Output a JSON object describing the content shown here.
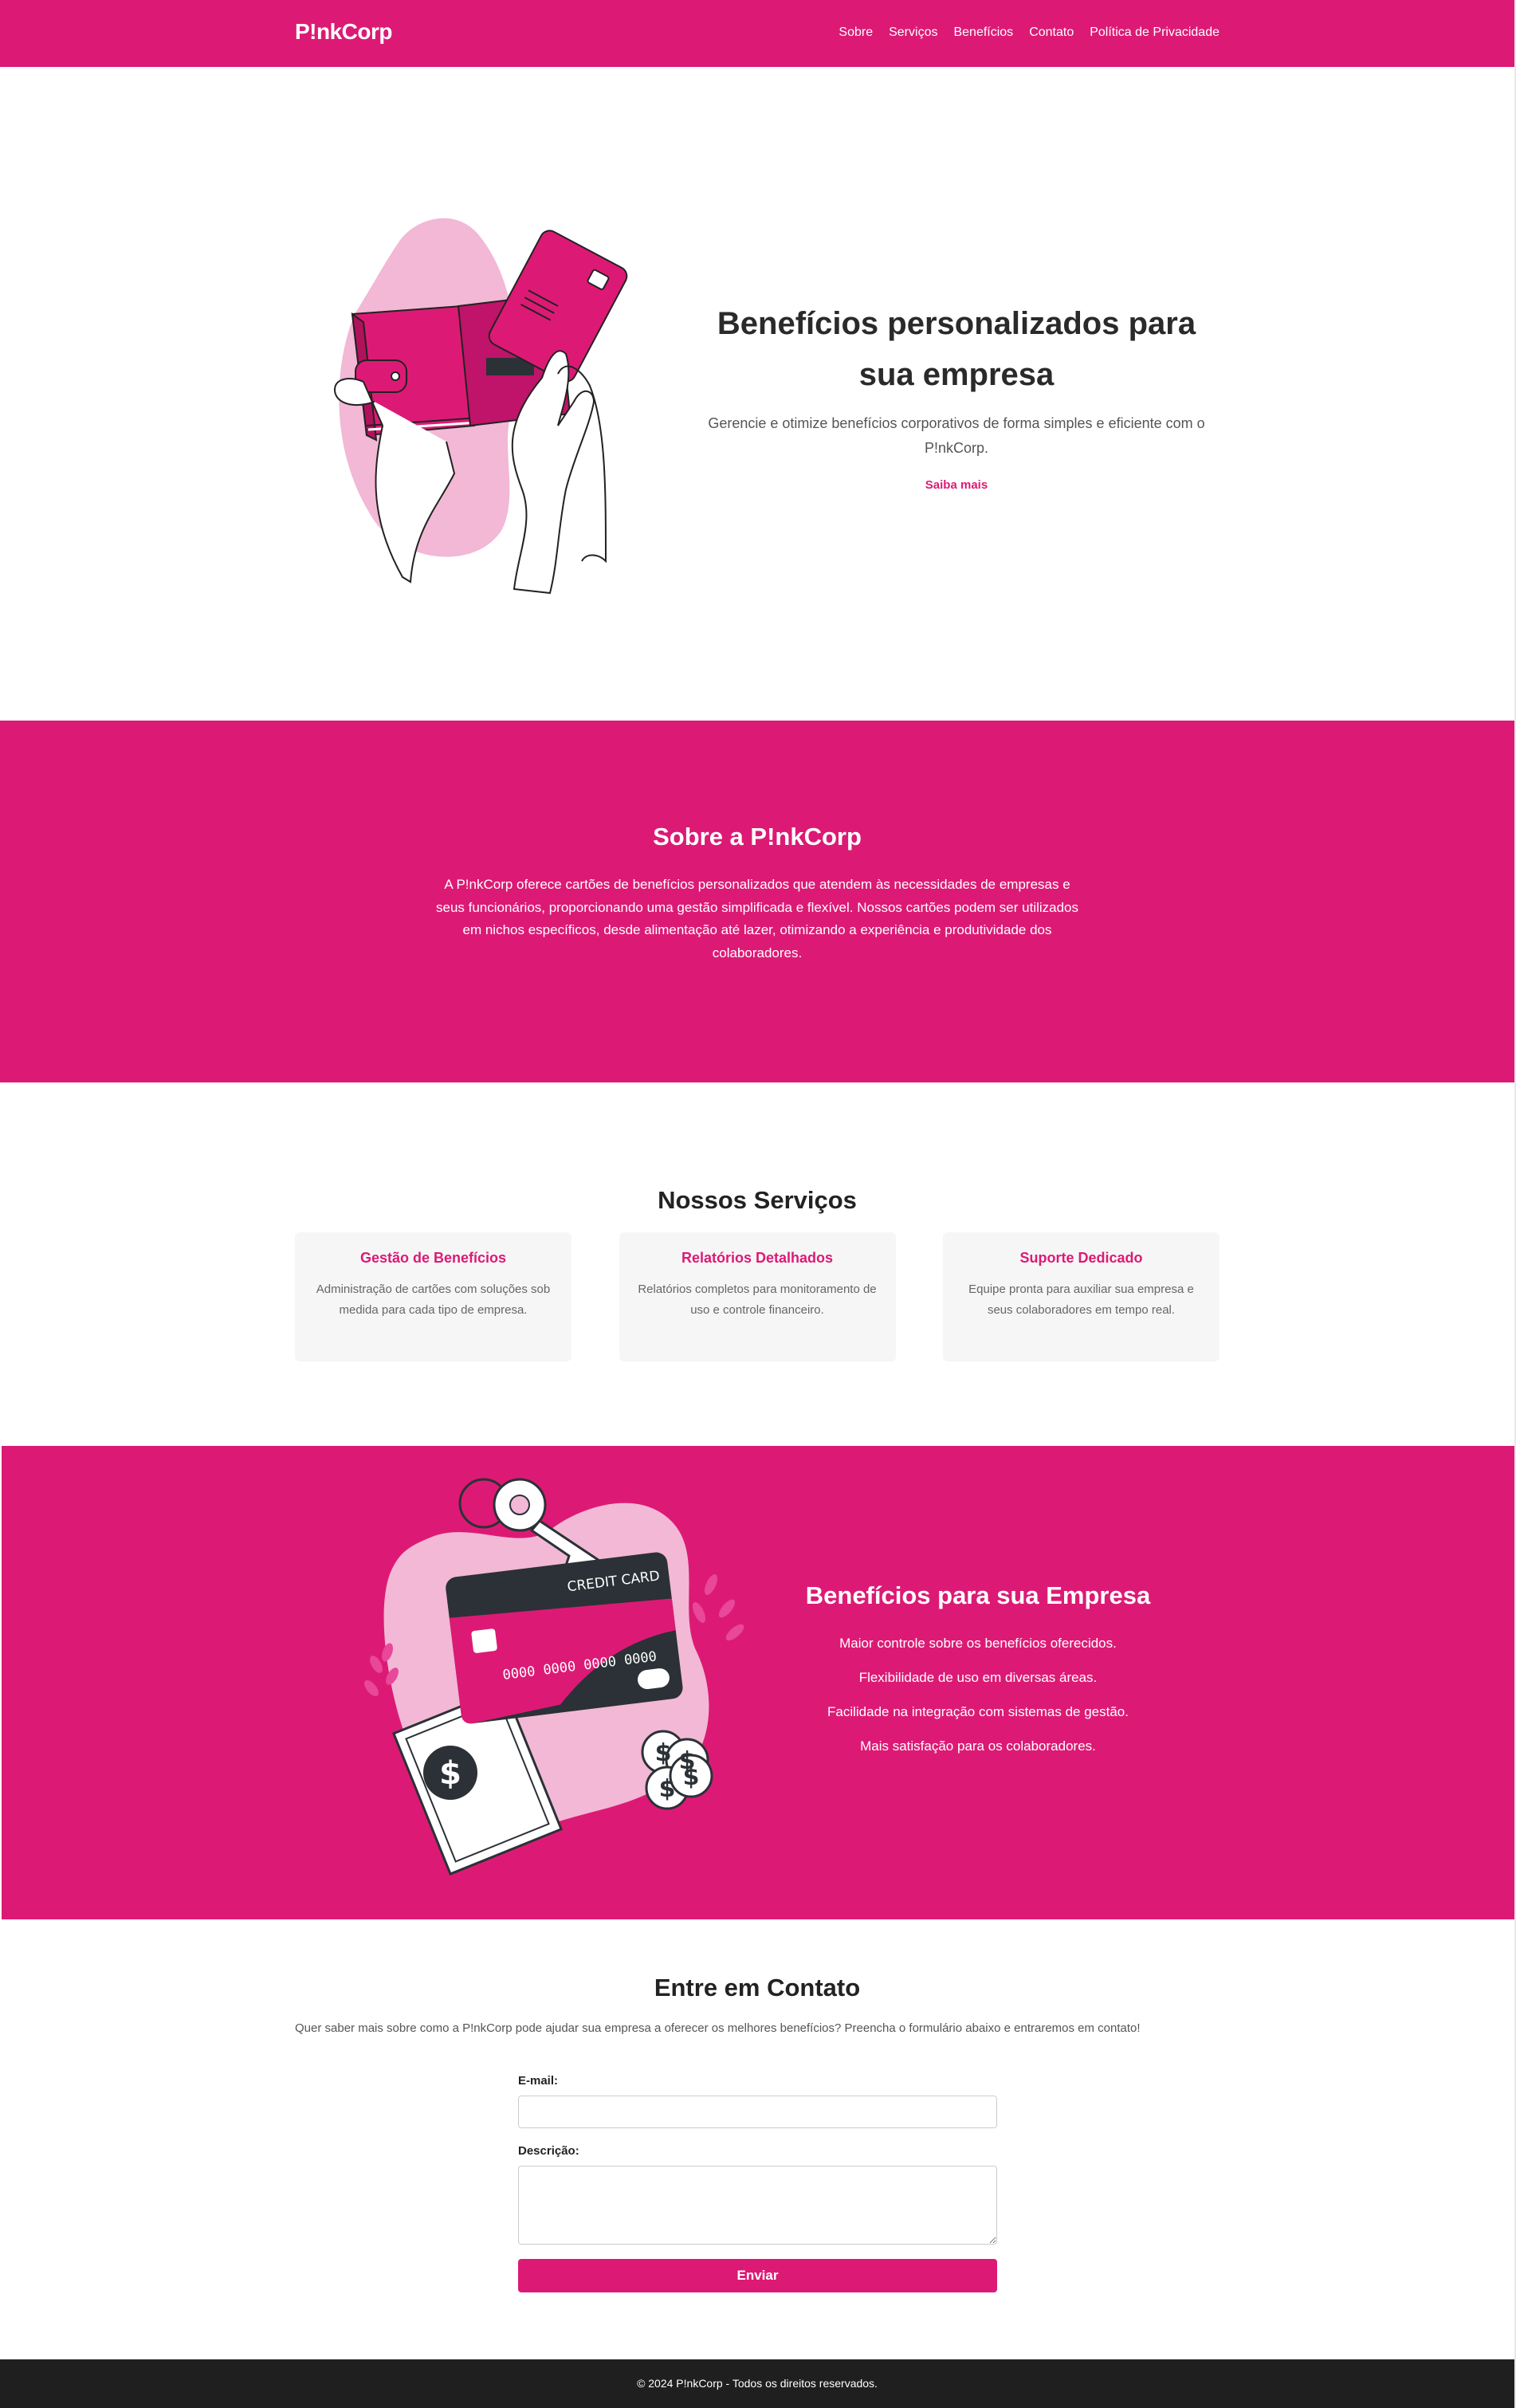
{
  "header": {
    "logo": "P!nkCorp",
    "nav": [
      "Sobre",
      "Serviços",
      "Benefícios",
      "Contato",
      "Política de Privacidade"
    ]
  },
  "hero": {
    "title": "Benefícios personalizados para sua empresa",
    "subtitle": "Gerencie e otimize benefícios corporativos de forma simples e eficiente com o P!nkCorp.",
    "link": "Saiba mais"
  },
  "about": {
    "title": "Sobre a P!nkCorp",
    "text": "A P!nkCorp oferece cartões de benefícios personalizados que atendem às necessidades de empresas e seus funcionários, proporcionando uma gestão simplificada e flexível. Nossos cartões podem ser utilizados em nichos específicos, desde alimentação até lazer, otimizando a experiência e produtividade dos colaboradores."
  },
  "services": {
    "title": "Nossos Serviços",
    "cards": [
      {
        "title": "Gestão de Benefícios",
        "text": "Administração de cartões com soluções sob medida para cada tipo de empresa."
      },
      {
        "title": "Relatórios Detalhados",
        "text": "Relatórios completos para monitoramento de uso e controle financeiro."
      },
      {
        "title": "Suporte Dedicado",
        "text": "Equipe pronta para auxiliar sua empresa e seus colaboradores em tempo real."
      }
    ]
  },
  "benefits": {
    "title": "Benefícios para sua Empresa",
    "items": [
      "Maior controle sobre os benefícios oferecidos.",
      "Flexibilidade de uso em diversas áreas.",
      "Facilidade na integração com sistemas de gestão.",
      "Mais satisfação para os colaboradores."
    ],
    "card_label": "CREDIT CARD",
    "card_number": "0000  0000  0000  0000"
  },
  "contact": {
    "title": "Entre em Contato",
    "intro": "Quer saber mais sobre como a P!nkCorp pode ajudar sua empresa a oferecer os melhores benefícios? Preencha o formulário abaixo e entraremos em contato!",
    "email_label": "E-mail:",
    "email_value": "",
    "description_label": "Descrição:",
    "description_value": "",
    "submit": "Enviar"
  },
  "footer": {
    "text": "© 2024 P!nkCorp - Todos os direitos reservados."
  },
  "colors": {
    "brand": "#dc1a75",
    "brand_light": "#f2b8d5",
    "dark": "#1f1f1f",
    "card_dark": "#2b3136"
  },
  "icons": [
    "wallet-hands-illustration",
    "credit-card-money-illustration",
    "dollar-coin-icon",
    "key-icon"
  ]
}
